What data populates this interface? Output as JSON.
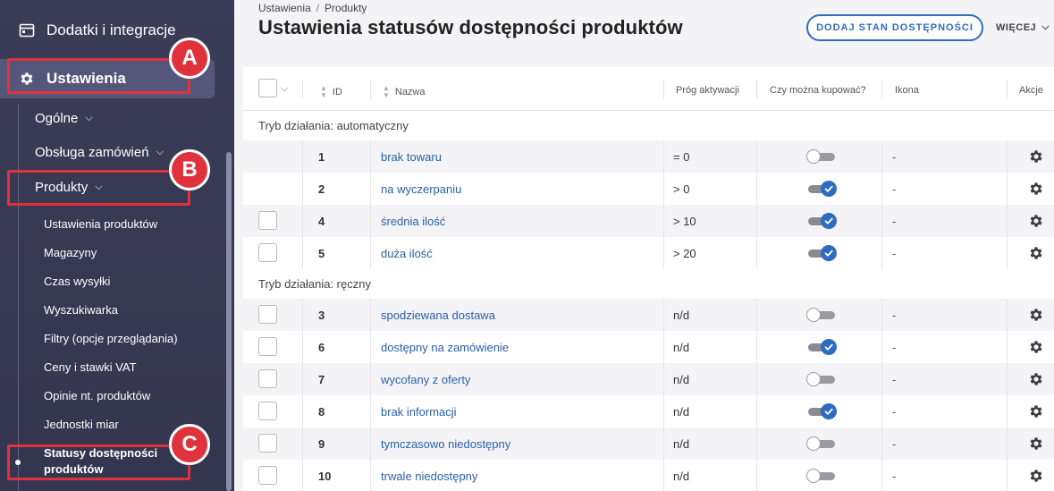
{
  "sidebar": {
    "dodatki_label": "Dodatki i integracje",
    "ustawienia_label": "Ustawienia",
    "sub_items": [
      {
        "label": "Ogólne"
      },
      {
        "label": "Obsługa zamówień"
      },
      {
        "label": "Produkty"
      }
    ],
    "leaf_items": [
      {
        "label": "Ustawienia produktów"
      },
      {
        "label": "Magazyny"
      },
      {
        "label": "Czas wysyłki"
      },
      {
        "label": "Wyszukiwarka"
      },
      {
        "label": "Filtry (opcje przeglądania)"
      },
      {
        "label": "Ceny i stawki VAT"
      },
      {
        "label": "Opinie nt. produktów"
      },
      {
        "label": "Jednostki miar"
      },
      {
        "label": "Statusy dostępności"
      },
      {
        "label": "produktów"
      }
    ],
    "badges": {
      "a": "A",
      "b": "B",
      "c": "C"
    }
  },
  "header": {
    "breadcrumb_1": "Ustawienia",
    "breadcrumb_sep": "/",
    "breadcrumb_2": "Produkty",
    "title": "Ustawienia statusów dostępności produktów",
    "add_button": "DODAJ STAN DOSTĘPNOŚCI",
    "more_button": "WIĘCEJ"
  },
  "table": {
    "columns": {
      "id": "ID",
      "name": "Nazwa",
      "threshold": "Próg aktywacji",
      "can_buy": "Czy można kupować?",
      "icon": "Ikona",
      "actions": "Akcje"
    },
    "group_auto": "Tryb działania: automatyczny",
    "group_manual": "Tryb działania: ręczny",
    "auto_rows": [
      {
        "id": "1",
        "name": "brak towaru",
        "threshold": "= 0",
        "can_buy": false,
        "icon": "-",
        "checkbox": false
      },
      {
        "id": "2",
        "name": "na wyczerpaniu",
        "threshold": "> 0",
        "can_buy": true,
        "icon": "-",
        "checkbox": false
      },
      {
        "id": "4",
        "name": "średnia ilość",
        "threshold": "> 10",
        "can_buy": true,
        "icon": "-",
        "checkbox": true
      },
      {
        "id": "5",
        "name": "duża ilość",
        "threshold": "> 20",
        "can_buy": true,
        "icon": "-",
        "checkbox": true
      }
    ],
    "manual_rows": [
      {
        "id": "3",
        "name": "spodziewana dostawa",
        "threshold": "n/d",
        "can_buy": false,
        "icon": "-",
        "checkbox": true
      },
      {
        "id": "6",
        "name": "dostępny na zamówienie",
        "threshold": "n/d",
        "can_buy": true,
        "icon": "-",
        "checkbox": true
      },
      {
        "id": "7",
        "name": "wycofany z oferty",
        "threshold": "n/d",
        "can_buy": false,
        "icon": "-",
        "checkbox": true
      },
      {
        "id": "8",
        "name": "brak informacji",
        "threshold": "n/d",
        "can_buy": true,
        "icon": "-",
        "checkbox": true
      },
      {
        "id": "9",
        "name": "tymczasowo niedostępny",
        "threshold": "n/d",
        "can_buy": false,
        "icon": "-",
        "checkbox": true
      },
      {
        "id": "10",
        "name": "trwale niedostępny",
        "threshold": "n/d",
        "can_buy": false,
        "icon": "-",
        "checkbox": true
      }
    ]
  },
  "colors": {
    "sidebar_bg": "#3b3c57",
    "accent_blue": "#2f6cbf",
    "highlight_red": "#e0323c"
  }
}
